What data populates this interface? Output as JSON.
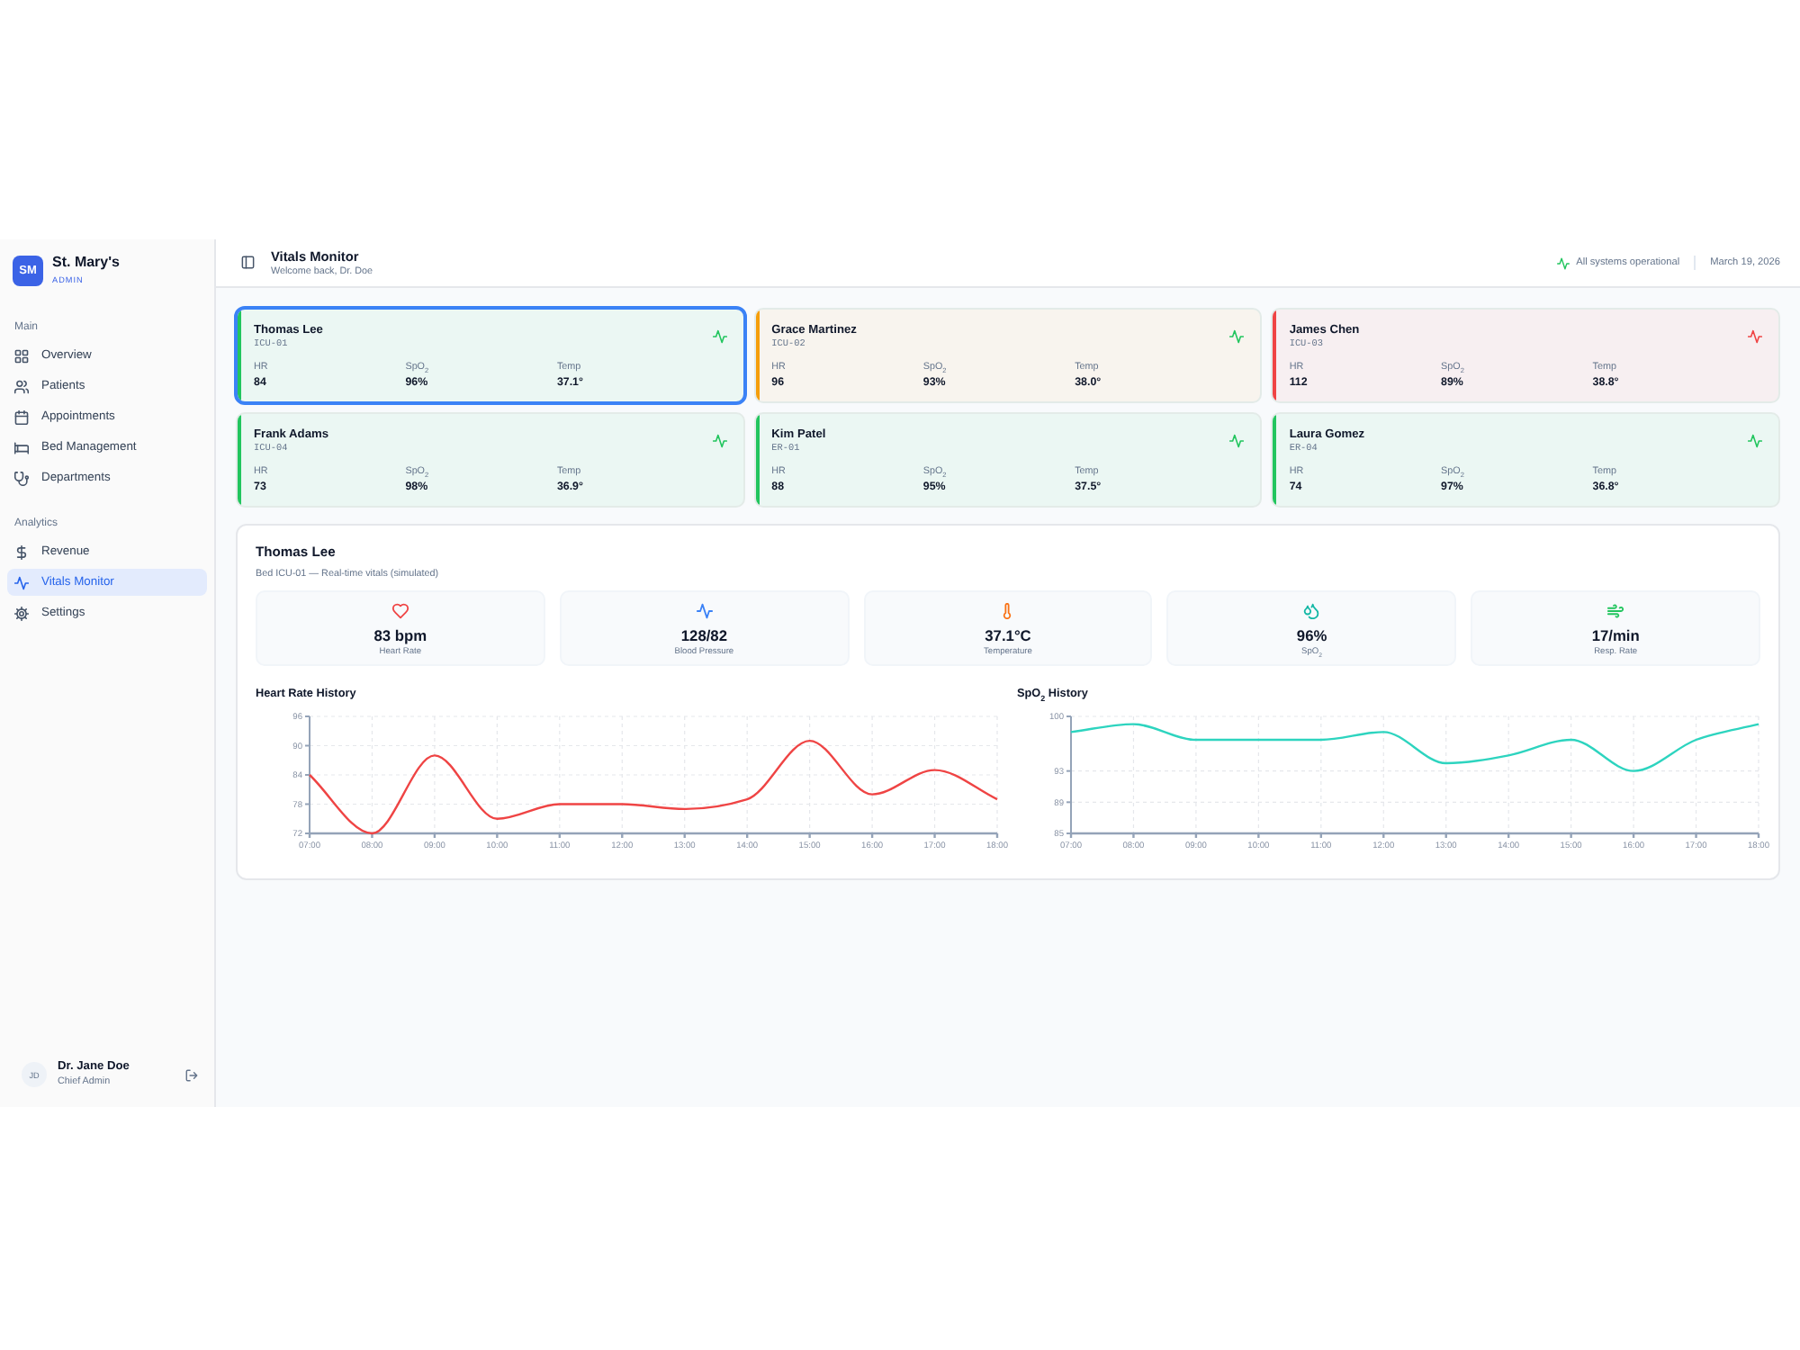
{
  "sidebar": {
    "logo": {
      "initials": "SM",
      "name": "St. Mary's",
      "subtitle": "ADMIN"
    },
    "sections": [
      {
        "label": "Main",
        "items": [
          {
            "label": "Overview",
            "selected": false
          },
          {
            "label": "Patients",
            "selected": false
          },
          {
            "label": "Appointments",
            "selected": false
          },
          {
            "label": "Bed Management",
            "selected": false
          },
          {
            "label": "Departments",
            "selected": false
          }
        ]
      },
      {
        "label": "Analytics",
        "items": [
          {
            "label": "Revenue",
            "selected": false
          },
          {
            "label": "Vitals Monitor",
            "selected": true
          },
          {
            "label": "Settings",
            "selected": false
          }
        ]
      }
    ],
    "user": {
      "initials": "JD",
      "name": "Dr. Jane Doe",
      "role": "Chief Admin"
    }
  },
  "header": {
    "title": "Vitals Monitor",
    "subtitle": "Welcome back, Dr. Doe",
    "status": "All systems operational",
    "date": "March 19, 2026"
  },
  "patients": [
    {
      "name": "Thomas Lee",
      "bed": "ICU-01",
      "color": "#22c55e",
      "alert": false,
      "selected": true,
      "vitals": [
        {
          "label": "HR",
          "value": "84"
        },
        {
          "label": "SpO$_{2}$",
          "value": "96%"
        },
        {
          "label": "Temp",
          "value": "37.1°"
        }
      ]
    },
    {
      "name": "Grace Martinez",
      "bed": "ICU-02",
      "color": "#f59e0b",
      "alert": false,
      "selected": false,
      "vitals": [
        {
          "label": "HR",
          "value": "96"
        },
        {
          "label": "SpO$_{2}$",
          "value": "93%"
        },
        {
          "label": "Temp",
          "value": "38.0°"
        }
      ]
    },
    {
      "name": "James Chen",
      "bed": "ICU-03",
      "color": "#ef4444",
      "alert": true,
      "selected": false,
      "vitals": [
        {
          "label": "HR",
          "value": "112"
        },
        {
          "label": "SpO$_{2}$",
          "value": "89%"
        },
        {
          "label": "Temp",
          "value": "38.8°"
        }
      ]
    },
    {
      "name": "Frank Adams",
      "bed": "ICU-04",
      "color": "#22c55e",
      "alert": false,
      "selected": false,
      "vitals": [
        {
          "label": "HR",
          "value": "73"
        },
        {
          "label": "SpO$_{2}$",
          "value": "98%"
        },
        {
          "label": "Temp",
          "value": "36.9°"
        }
      ]
    },
    {
      "name": "Kim Patel",
      "bed": "ER-01",
      "color": "#22c55e",
      "alert": false,
      "selected": false,
      "vitals": [
        {
          "label": "HR",
          "value": "88"
        },
        {
          "label": "SpO$_{2}$",
          "value": "95%"
        },
        {
          "label": "Temp",
          "value": "37.5°"
        }
      ]
    },
    {
      "name": "Laura Gomez",
      "bed": "ER-04",
      "color": "#22c55e",
      "alert": false,
      "selected": false,
      "vitals": [
        {
          "label": "HR",
          "value": "74"
        },
        {
          "label": "SpO$_{2}$",
          "value": "97%"
        },
        {
          "label": "Temp",
          "value": "36.8°"
        }
      ]
    }
  ],
  "detail": {
    "name": "Thomas Lee",
    "subtitle": "Bed ICU-01 — Real-time vitals (simulated)",
    "stats": [
      {
        "kind": "heart_rate",
        "value": "83 bpm",
        "label": "Heart Rate"
      },
      {
        "kind": "blood_pressure",
        "value": "128/82",
        "label": "Blood Pressure"
      },
      {
        "kind": "temperature",
        "value": "37.1°C",
        "label": "Temperature"
      },
      {
        "kind": "oxygen",
        "value": "96%",
        "label": "SpO$_{2}$"
      },
      {
        "kind": "respiration",
        "value": "17/min",
        "label": "Resp. Rate"
      }
    ],
    "charts": [
      {
        "chart_data": {
          "type": "line",
          "title": "Heart Rate History",
          "grid": true,
          "categories": [
            "07:00",
            "08:00",
            "09:00",
            "10:00",
            "11:00",
            "12:00",
            "13:00",
            "14:00",
            "15:00",
            "16:00",
            "17:00",
            "18:00"
          ],
          "series": [
            {
              "color": "#ef4444",
              "values": [
                84,
                72,
                88,
                75,
                78,
                78,
                77,
                79,
                91,
                80,
                85,
                79
              ]
            }
          ],
          "ylim": [
            72,
            96
          ],
          "yticks": [
            72,
            78,
            84,
            90,
            96
          ]
        }
      },
      {
        "chart_data": {
          "type": "line",
          "title": "SpO$_{2}$ History",
          "grid": true,
          "categories": [
            "07:00",
            "08:00",
            "09:00",
            "10:00",
            "11:00",
            "12:00",
            "13:00",
            "14:00",
            "15:00",
            "16:00",
            "17:00",
            "18:00"
          ],
          "series": [
            {
              "color": "#2dd4bf",
              "values": [
                98,
                99,
                97,
                97,
                97,
                98,
                94,
                95,
                97,
                93,
                97,
                99
              ]
            }
          ],
          "ylim": [
            85,
            100
          ],
          "yticks": [
            85,
            89,
            93,
            100
          ]
        }
      }
    ]
  }
}
